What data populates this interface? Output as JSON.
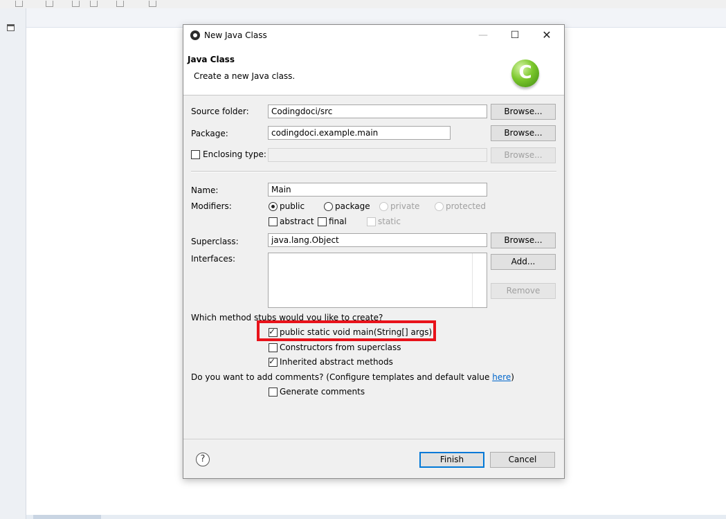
{
  "window": {
    "title": "New Java Class"
  },
  "header": {
    "title": "Java Class",
    "description": "Create a new Java class.",
    "logo_letter": "C"
  },
  "fields": {
    "source_folder": {
      "label": "Source folder:",
      "value": "Codingdoci/src",
      "button": "Browse..."
    },
    "package": {
      "label": "Package:",
      "value": "codingdoci.example.main",
      "button": "Browse..."
    },
    "enclosing_type": {
      "label": "Enclosing type:",
      "value": "",
      "button": "Browse...",
      "checked": false
    },
    "name": {
      "label": "Name:",
      "value": "Main"
    },
    "modifiers": {
      "label": "Modifiers:",
      "radios": [
        "public",
        "package",
        "private",
        "protected"
      ],
      "selected": "public",
      "checkboxes": [
        "abstract",
        "final",
        "static"
      ]
    },
    "superclass": {
      "label": "Superclass:",
      "value": "java.lang.Object",
      "button": "Browse..."
    },
    "interfaces": {
      "label": "Interfaces:",
      "add_button": "Add...",
      "remove_button": "Remove"
    }
  },
  "stubs": {
    "question": "Which method stubs would you like to create?",
    "options": [
      {
        "label": "public static void main(String[] args)",
        "checked": true
      },
      {
        "label": "Constructors from superclass",
        "checked": false
      },
      {
        "label": "Inherited abstract methods",
        "checked": true
      }
    ]
  },
  "comments": {
    "question_prefix": "Do you want to add comments? (Configure templates and default value ",
    "link": "here",
    "question_suffix": ")",
    "generate_label": "Generate comments",
    "checked": false
  },
  "footer": {
    "help": "?",
    "finish": "Finish",
    "cancel": "Cancel"
  },
  "colors": {
    "highlight": "#e8121a",
    "link": "#0066cc",
    "default_button_border": "#0078d7",
    "logo_green": "#7bc72c"
  }
}
